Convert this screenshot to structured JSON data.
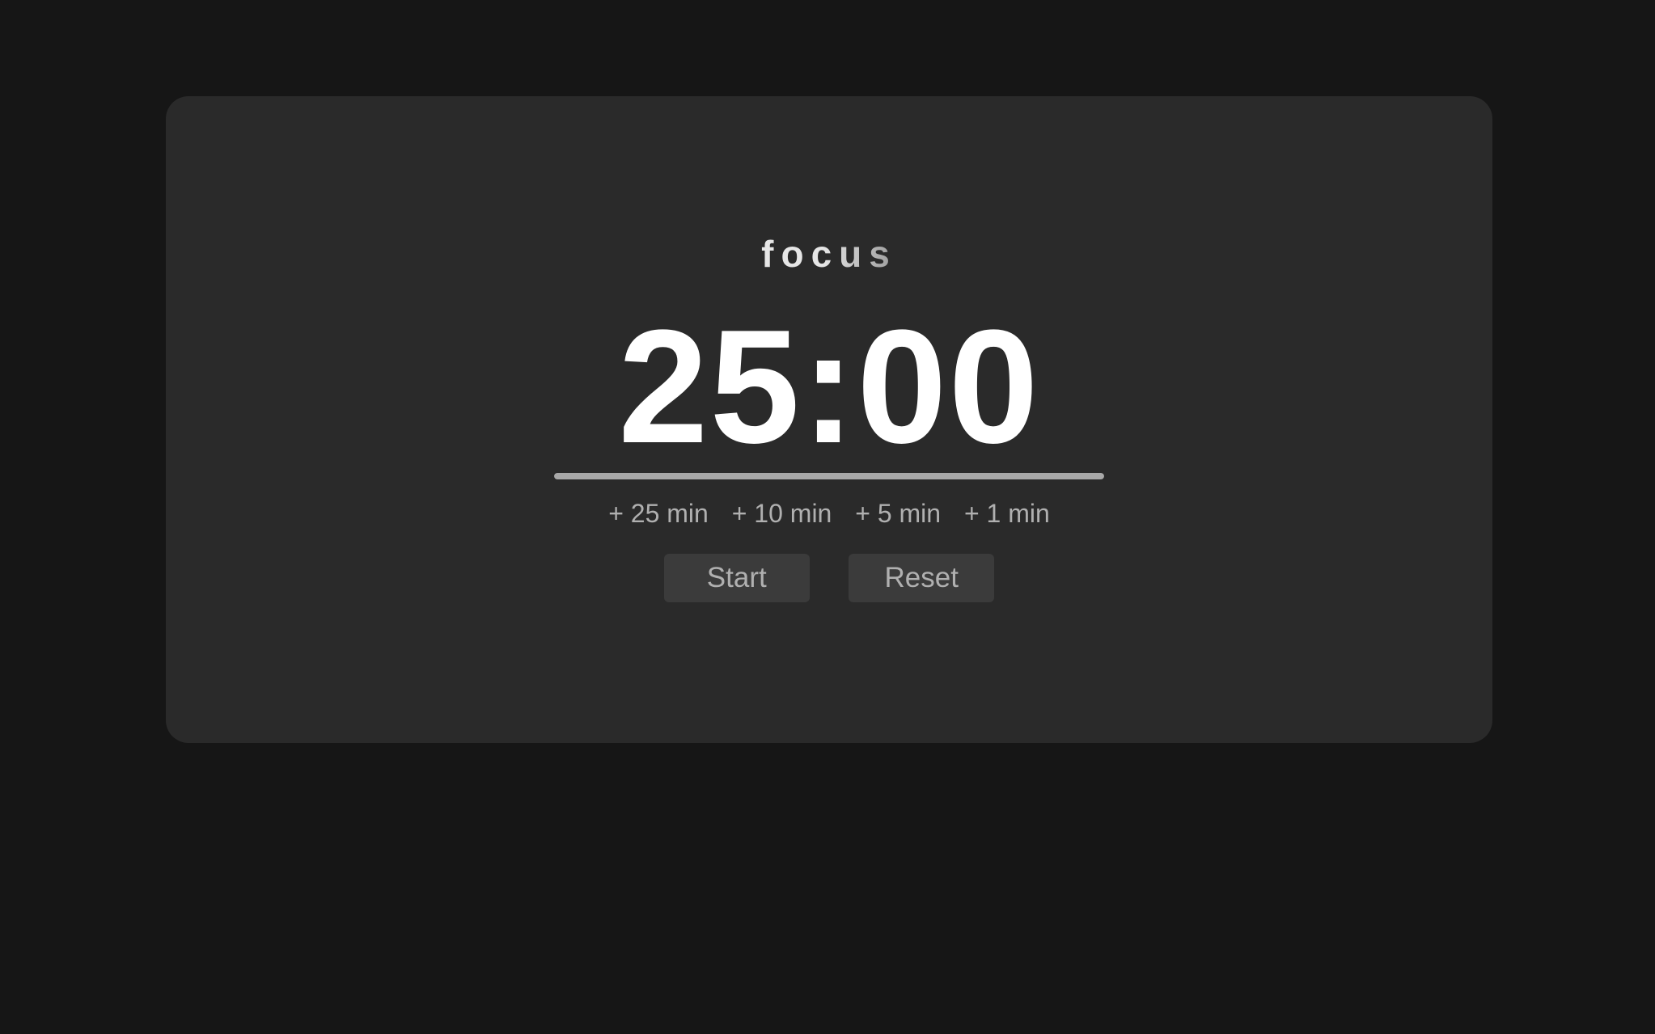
{
  "timer": {
    "mode_label": "focus",
    "time": "25:00",
    "progress": 1.0
  },
  "increments": [
    {
      "label": "+ 25 min"
    },
    {
      "label": "+ 10 min"
    },
    {
      "label": "+ 5 min"
    },
    {
      "label": "+ 1 min"
    }
  ],
  "controls": {
    "start_label": "Start",
    "reset_label": "Reset"
  },
  "colors": {
    "page_background": "#161616",
    "card_background": "#2a2a2a",
    "text_primary": "#ffffff",
    "text_muted": "#b0b0b0",
    "button_background": "#3b3b3b",
    "progress_fill": "#a8a8a8"
  }
}
